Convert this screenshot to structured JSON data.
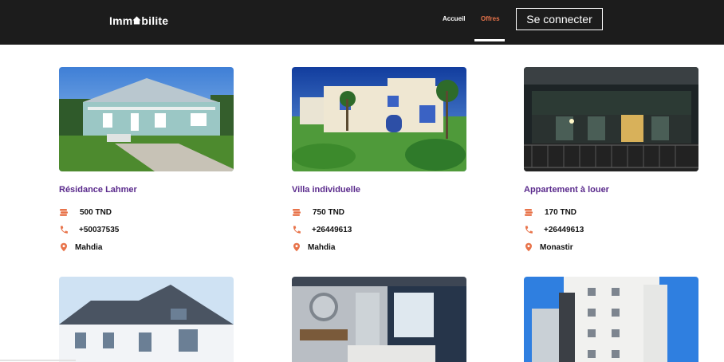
{
  "brand": {
    "prefix": "Imm",
    "suffix": "bilite"
  },
  "nav": {
    "home": "Accueil",
    "offers": "Offres",
    "login": "Se connecter"
  },
  "colors": {
    "accent": "#e8734a",
    "title": "#5a2a8c",
    "navbar": "#1c1c1c"
  },
  "listings": [
    {
      "title": "Résidance Lahmer",
      "price": "500 TND",
      "phone": "+50037535",
      "city": "Mahdia"
    },
    {
      "title": "Villa individuelle",
      "price": "750 TND",
      "phone": "+26449613",
      "city": "Mahdia"
    },
    {
      "title": "Appartement à louer",
      "price": "170 TND",
      "phone": "+26449613",
      "city": "Monastir"
    }
  ],
  "icons": {
    "price": "coins-icon",
    "phone": "phone-icon",
    "city": "map-pin-icon"
  }
}
